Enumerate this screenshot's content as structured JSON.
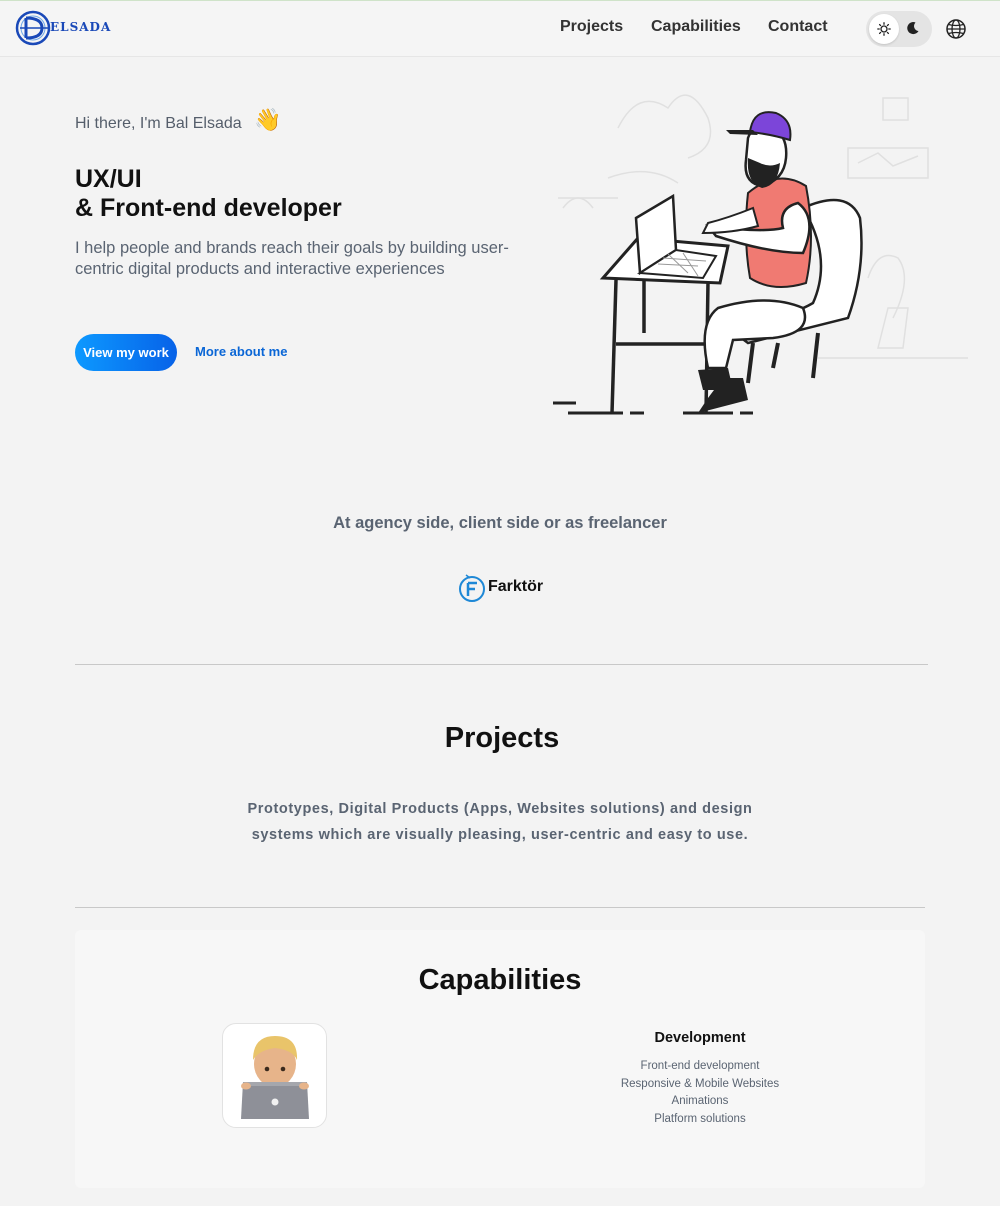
{
  "header": {
    "logo_text": "ELSADA",
    "nav": [
      "Projects",
      "Capabilities",
      "Contact"
    ],
    "theme_toggle": {
      "light_icon": "sun-icon",
      "dark_icon": "moon-icon",
      "selected": "light"
    },
    "language_icon": "globe-icon"
  },
  "hero": {
    "greeting": "Hi there, I'm Bal Elsada",
    "wave_emoji": "👋",
    "title_line1": "UX/UI",
    "title_line2": "& Front-end developer",
    "subtitle": "I help people and brands reach their goals by building user-centric digital products and interactive experiences",
    "primary_button": "View my work",
    "secondary_link": "More about me",
    "illustration": "developer-at-desk-illustration"
  },
  "clients": {
    "title": "At agency side, client side or as freelancer",
    "logos": [
      {
        "name": "Farktör",
        "icon": "farktor-logo-icon"
      }
    ]
  },
  "projects": {
    "title": "Projects",
    "description_line1": "Prototypes, Digital Products (Apps, Websites solutions) and design",
    "description_line2": "systems which are visually pleasing, user-centric and easy to use."
  },
  "capabilities": {
    "title": "Capabilities",
    "items": [
      {
        "icon": "technologist-emoji-icon",
        "heading": "Development",
        "list": [
          "Front-end development",
          "Responsive & Mobile Websites",
          "Animations",
          "Platform solutions"
        ]
      }
    ]
  },
  "colors": {
    "accent_start": "#0d99ff",
    "accent_end": "#0762e8",
    "link": "#0a66d6",
    "muted_text": "#5a6472",
    "background": "#f3f3f3"
  }
}
